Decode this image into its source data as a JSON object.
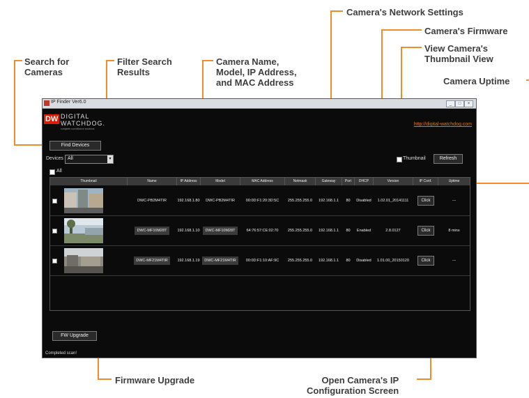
{
  "callouts": {
    "search": [
      "Search for",
      "Cameras"
    ],
    "filter": [
      "Filter Search",
      "Results"
    ],
    "camera_info": [
      "Camera Name,",
      "Model, IP Address,",
      "and MAC Address"
    ],
    "network": "Camera's Network Settings",
    "firmware": "Camera's Firmware",
    "thumbnail_view": [
      "View Camera's",
      "Thumbnail View"
    ],
    "uptime": "Camera Uptime",
    "fw_upgrade": "Firmware Upgrade",
    "ip_config": [
      "Open Camera's IP",
      "Configuration Screen"
    ]
  },
  "app": {
    "title": "IP Finder Ver6.0",
    "logo": {
      "mark": "DW",
      "line1": "DIGITAL",
      "line2": "WATCHDOG.",
      "tagline": "complete surveillance solutions"
    },
    "link": "http://digital-watchdog.com",
    "find_button": "Find Devices",
    "devices_label": "Devices",
    "devices_selected": "All",
    "all_label": "All",
    "thumbnail_label": "Thumbnail",
    "refresh_button": "Refresh",
    "fw_button": "FW Upgrade",
    "status": "Completed scan!",
    "accent_color": "#f28c28",
    "columns": [
      "Thumbnail",
      "Name",
      "IP Address",
      "Model",
      "MAC Address",
      "Netmask",
      "Gateway",
      "Port",
      "DHCP",
      "Version",
      "IP Conf.",
      "Uptime"
    ],
    "rows": [
      {
        "name": "DWC-PB2M4TIR",
        "ip": "192.168.1.80",
        "model": "DWC-PB2M4TIR",
        "mac": "00:0D:F1:20:3D:5C",
        "netmask": "255.255.255.0",
        "gateway": "192.168.1.1",
        "port": "80",
        "dhcp": "Disabled",
        "version": "1.02.01_20141111",
        "ipconf": "Click",
        "uptime": "---"
      },
      {
        "name": "DWC-MF10M28T",
        "ip": "192.168.1.10",
        "model": "DWC-MF10M28T",
        "mac": "64:76:57:CE:02:70",
        "netmask": "255.255.255.0",
        "gateway": "192.168.1.1",
        "port": "80",
        "dhcp": "Enabled",
        "version": "2.8.0127",
        "ipconf": "Click",
        "uptime": "8 mins"
      },
      {
        "name": "DWC-MF21M4TIR",
        "ip": "192.168.1.19",
        "model": "DWC-MF21M4TIR",
        "mac": "00:0D:F1:10:AF:9C",
        "netmask": "255.255.255.0",
        "gateway": "192.168.1.1",
        "port": "80",
        "dhcp": "Disabled",
        "version": "1.01.00_20150120",
        "ipconf": "Click",
        "uptime": "---"
      }
    ]
  }
}
